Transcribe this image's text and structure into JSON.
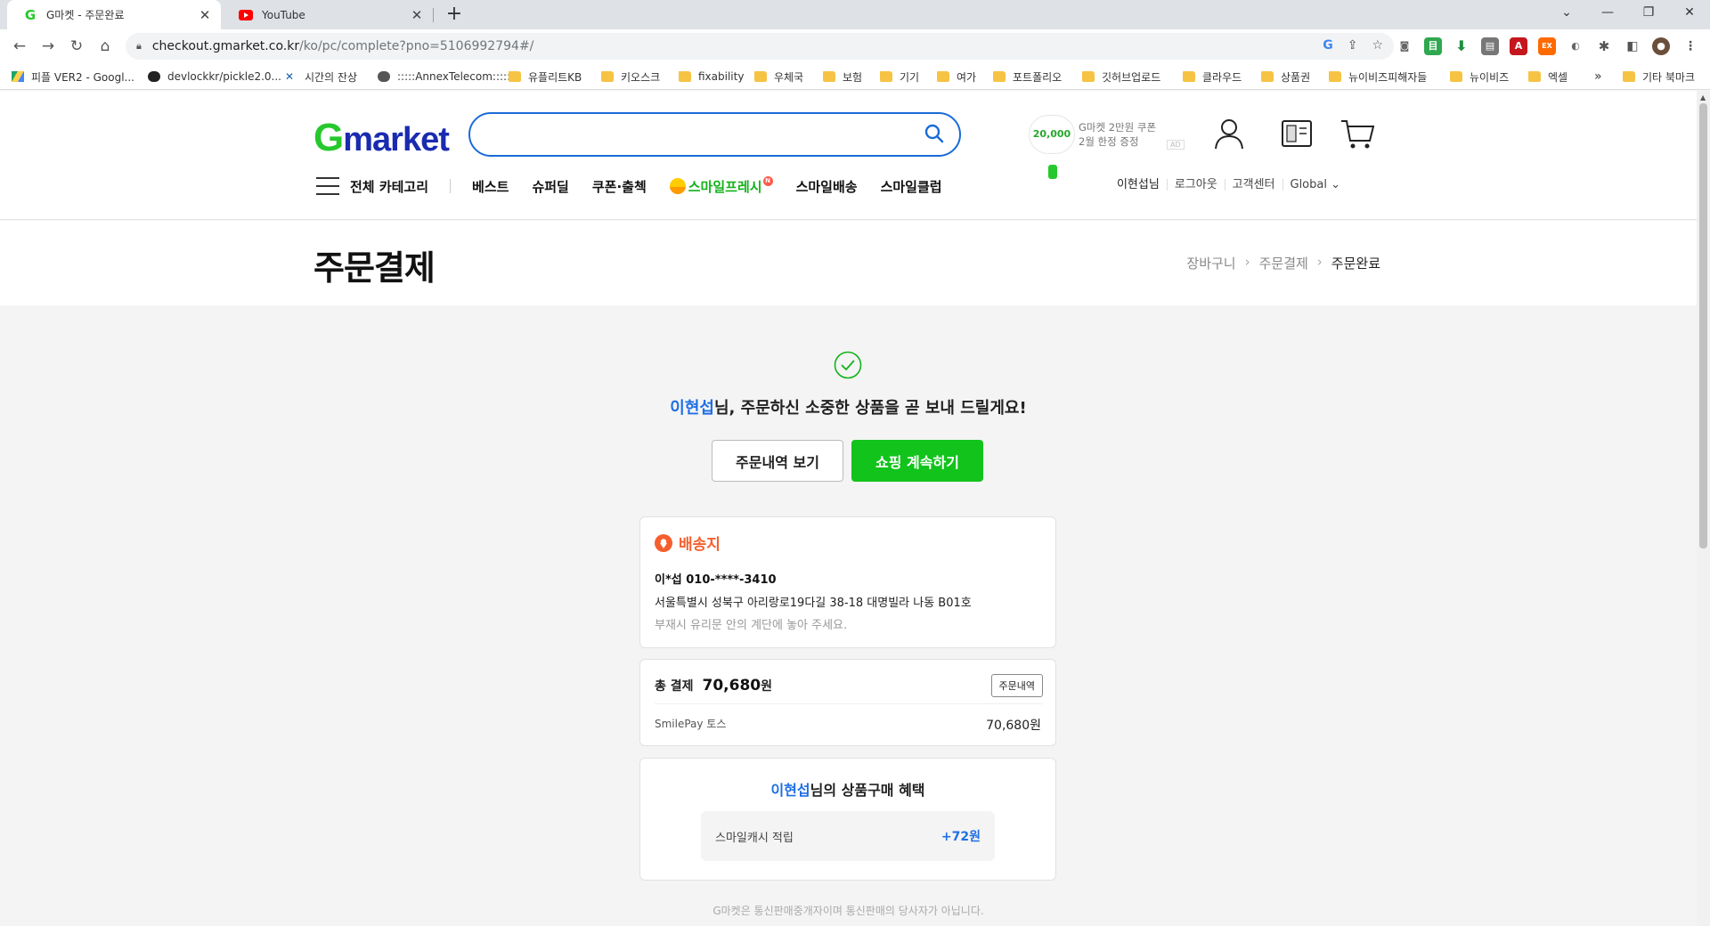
{
  "browser": {
    "tabs": [
      {
        "title": "G마켓 - 주문완료",
        "favicon": "gmarket-g-icon"
      },
      {
        "title": "YouTube",
        "favicon": "youtube-icon"
      }
    ],
    "url_host": "checkout.gmarket.co.kr",
    "url_path": "/ko/pc/complete?pno=5106992794#/",
    "bookmarks": [
      "피플 VER2 - Googl...",
      "devlockkr/pickle2.0...",
      "시간의 잔상",
      ":::::AnnexTelecom:::::",
      "유플리트KB",
      "키오스크",
      "fixability",
      "우체국",
      "보험",
      "기기",
      "여가",
      "포트폴리오",
      "깃허브업로드",
      "클라우드",
      "상품권",
      "뉴이비즈피해자들",
      "뉴이비즈",
      "엑셀"
    ],
    "more_bookmarks": "»",
    "other_bookmarks": "기타 북마크"
  },
  "header": {
    "logo_g": "G",
    "logo_rest": "market",
    "promo": {
      "coin": "20,000",
      "line1": "G마켓 2만원 쿠폰",
      "line2": "2월 한정 증정",
      "ad": "AD"
    },
    "gnb": {
      "all_categories": "전체 카테고리",
      "items": [
        "베스트",
        "슈퍼딜",
        "쿠폰·출첵"
      ],
      "fresh": "스마일프레시",
      "fresh_badge": "N",
      "items2": [
        "스마일배송",
        "스마일클럽"
      ]
    },
    "util": {
      "user": "이현섭님",
      "logout": "로그아웃",
      "help": "고객센터",
      "global": "Global ⌄"
    }
  },
  "title": {
    "page_title": "주문결제",
    "breadcrumb": [
      "장바구니",
      "주문결제",
      "주문완료"
    ]
  },
  "complete": {
    "user_name": "이현섭",
    "message": "님, 주문하신 소중한 상품을 곧 보내 드릴게요!",
    "btn_history": "주문내역 보기",
    "btn_continue": "쇼핑 계속하기"
  },
  "shipping": {
    "title": "배송지",
    "recipient": "이*섭  010-****-3410",
    "address": "서울특별시 성북구 아리랑로19다길 38-18 대명빌라 나동 B01호",
    "memo": "부재시 유리문 안의 계단에 놓아 주세요."
  },
  "payment": {
    "label": "총 결제",
    "amount": "70,680",
    "won": "원",
    "order_button": "주문내역",
    "method": "SmilePay 토스",
    "method_amount": "70,680원"
  },
  "benefit": {
    "user_name": "이현섭",
    "title_rest": "님의 상품구매 혜택",
    "item": "스마일캐시 적립",
    "value": "+72원"
  },
  "footer": {
    "notice": "G마켓은 통신판매중개자이며 통신판매의 당사자가 아닙니다."
  }
}
